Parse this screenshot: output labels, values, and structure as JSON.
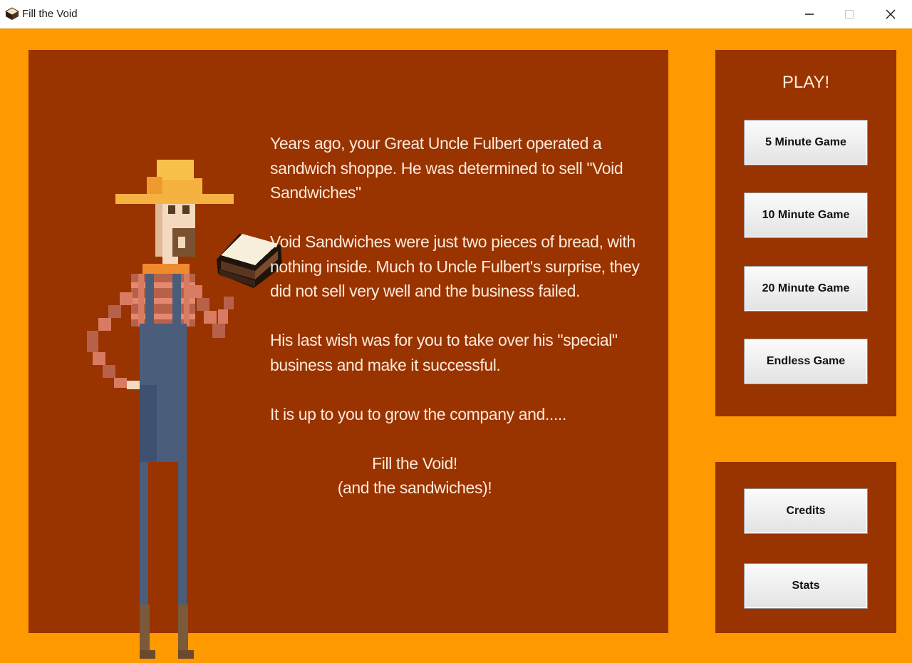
{
  "window": {
    "title": "Fill the Void",
    "icons": {
      "app": "sandwich-icon",
      "minimize": "minimize-icon",
      "maximize": "maximize-icon",
      "close": "close-icon"
    }
  },
  "story": {
    "paragraphs": [
      "Years ago, your Great Uncle Fulbert operated a sandwich shoppe.  He was determined to sell \"Void Sandwiches\"",
      "Void Sandwiches were just two pieces of bread, with nothing inside.  Much to Uncle Fulbert's surprise, they did not sell very well and the business failed.",
      "His last wish was for you to take over his \"special\" business and make it successful.",
      "It is up to you to grow the company and....."
    ],
    "closing_line_1": "Fill the Void!",
    "closing_line_2": "(and the sandwiches)!"
  },
  "play_panel": {
    "title": "PLAY!",
    "buttons": [
      "5 Minute Game",
      "10 Minute Game",
      "20 Minute Game",
      "Endless Game"
    ]
  },
  "menu_panel": {
    "buttons": [
      "Credits",
      "Stats"
    ]
  },
  "colors": {
    "background": "#ff9900",
    "panel": "#993300",
    "text": "#fde9d9"
  }
}
